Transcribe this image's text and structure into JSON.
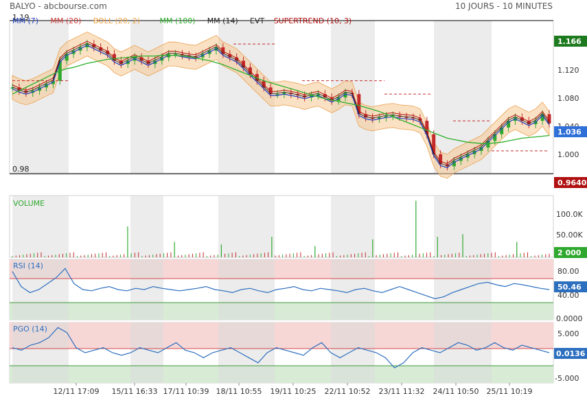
{
  "header": {
    "title": "BALYO - abcbourse.com",
    "period": "10 JOURS - 10 MINUTES"
  },
  "legend": [
    {
      "label": "MM (7)",
      "color": "#1f3fbf"
    },
    {
      "label": "MM (20)",
      "color": "#d23a3a"
    },
    {
      "label": "BOLL (20, 2)",
      "color": "#f0a64a"
    },
    {
      "label": "MM (100)",
      "color": "#2ab02a"
    },
    {
      "label": "MM (14)",
      "color": "#222222"
    },
    {
      "label": "EVT",
      "color": "#222222"
    },
    {
      "label": "SUPERTREND (10, 3)",
      "color": "#b01010"
    }
  ],
  "price_panel": {
    "top_label": "1.19",
    "low_label": "0.98",
    "ticks": [
      "1.120",
      "1.080",
      "1.040",
      "1.000"
    ],
    "high_badge": "1.166",
    "last_badge": "1.036",
    "low_badge": "0.9640",
    "colors": {
      "high": "#1e7a1e",
      "last": "#2f6fd8",
      "low": "#b01010",
      "candle_up": "#2fa82f",
      "candle_down": "#c42a2a",
      "band": "#f7c992"
    }
  },
  "volume_panel": {
    "title": "VOLUME",
    "ticks": [
      "100.0K",
      "50.00K"
    ],
    "badge": "2 000",
    "colors": {
      "title": "#2fa82f",
      "badge": "#2fa82f"
    }
  },
  "rsi_panel": {
    "title": "RSI (14)",
    "ticks": [
      "80.00",
      "40.00",
      "0.0000"
    ],
    "badge": "50.46",
    "colors": {
      "line": "#2c6fbf",
      "badge": "#2c6fbf"
    }
  },
  "pgo_panel": {
    "title": "PGO (14)",
    "ticks": [
      "5.000",
      "-5.000"
    ],
    "badge": "0.0136",
    "colors": {
      "line": "#2c6fbf",
      "badge": "#2c6fbf"
    }
  },
  "x_axis": {
    "labels": [
      "12/11 17:09",
      "15/11 16:33",
      "17/11 10:39",
      "18/11 10:55",
      "19/11 10:25",
      "22/11 10:52",
      "23/11 11:32",
      "24/11 10:50",
      "25/11 10:19"
    ]
  },
  "chart_data": {
    "type": "line",
    "title": "BALYO - abcbourse.com",
    "x_tick_labels": [
      "12/11 17:09",
      "15/11 16:33",
      "17/11 10:39",
      "18/11 10:55",
      "19/11 10:25",
      "22/11 10:52",
      "23/11 11:32",
      "24/11 10:50",
      "25/11 10:19"
    ],
    "price": {
      "ylim": [
        0.96,
        1.19
      ],
      "close": [
        1.09,
        1.085,
        1.082,
        1.085,
        1.09,
        1.095,
        1.1,
        1.13,
        1.14,
        1.145,
        1.15,
        1.155,
        1.15,
        1.145,
        1.14,
        1.13,
        1.125,
        1.13,
        1.135,
        1.13,
        1.125,
        1.13,
        1.135,
        1.14,
        1.14,
        1.138,
        1.136,
        1.135,
        1.14,
        1.145,
        1.15,
        1.14,
        1.135,
        1.13,
        1.12,
        1.11,
        1.1,
        1.09,
        1.08,
        1.08,
        1.082,
        1.08,
        1.078,
        1.075,
        1.078,
        1.08,
        1.075,
        1.07,
        1.075,
        1.082,
        1.08,
        1.05,
        1.045,
        1.043,
        1.045,
        1.047,
        1.048,
        1.046,
        1.045,
        1.044,
        1.04,
        1.02,
        0.99,
        0.975,
        0.972,
        0.98,
        0.985,
        0.99,
        0.995,
        1.0,
        1.01,
        1.02,
        1.03,
        1.04,
        1.045,
        1.04,
        1.035,
        1.04,
        1.05,
        1.036
      ],
      "ma100": [
        1.08,
        1.085,
        1.09,
        1.095,
        1.1,
        1.105,
        1.11,
        1.115,
        1.118,
        1.12,
        1.123,
        1.126,
        1.128,
        1.13,
        1.132,
        1.133,
        1.134,
        1.135,
        1.136,
        1.137,
        1.137,
        1.137,
        1.138,
        1.138,
        1.138,
        1.137,
        1.136,
        1.134,
        1.132,
        1.13,
        1.127,
        1.124,
        1.12,
        1.116,
        1.112,
        1.108,
        1.104,
        1.1,
        1.097,
        1.094,
        1.091,
        1.088,
        1.085,
        1.082,
        1.079,
        1.076,
        1.073,
        1.071,
        1.069,
        1.067,
        1.065,
        1.063,
        1.06,
        1.057,
        1.054,
        1.05,
        1.046,
        1.042,
        1.038,
        1.034,
        1.03,
        1.026,
        1.022,
        1.018,
        1.014,
        1.012,
        1.01,
        1.008,
        1.007,
        1.006,
        1.006,
        1.007,
        1.008,
        1.01,
        1.012,
        1.014,
        1.015,
        1.016,
        1.017,
        1.018
      ]
    },
    "volume": {
      "ylim": [
        0,
        120000
      ],
      "spikes": [
        [
          32,
          60000
        ],
        [
          45,
          30000
        ],
        [
          58,
          25000
        ],
        [
          72,
          40000
        ],
        [
          84,
          22000
        ],
        [
          100,
          35000
        ],
        [
          112,
          110000
        ],
        [
          118,
          40000
        ],
        [
          125,
          45000
        ],
        [
          140,
          30000
        ]
      ]
    },
    "rsi": {
      "ylim": [
        0,
        100
      ],
      "bands": [
        70,
        30
      ],
      "values": [
        80,
        55,
        45,
        50,
        60,
        70,
        85,
        60,
        50,
        48,
        52,
        55,
        50,
        48,
        52,
        50,
        55,
        52,
        50,
        48,
        50,
        52,
        55,
        50,
        48,
        45,
        50,
        52,
        48,
        45,
        50,
        52,
        55,
        50,
        48,
        52,
        50,
        48,
        45,
        50,
        52,
        48,
        45,
        50,
        55,
        50,
        45,
        40,
        35,
        38,
        45,
        50,
        55,
        60,
        62,
        58,
        55,
        60,
        58,
        55,
        52,
        50
      ]
    },
    "pgo": {
      "ylim": [
        -6,
        6
      ],
      "bands": [
        3,
        -3
      ],
      "values": [
        1,
        0.5,
        1.5,
        2,
        3,
        5,
        4,
        1,
        0,
        0.5,
        1,
        0,
        -0.5,
        0,
        1,
        0.5,
        0,
        1,
        2,
        0.5,
        0,
        -1,
        0,
        0.5,
        1,
        0,
        -1,
        -2,
        0,
        1,
        0.5,
        0,
        -0.5,
        1,
        2,
        0,
        -1,
        0,
        1,
        0.5,
        0,
        -1,
        -3,
        -2,
        0,
        1,
        0.5,
        0,
        1,
        2,
        1.5,
        0.5,
        1,
        2,
        1,
        0.5,
        1.5,
        1,
        0.5,
        0
      ]
    }
  }
}
